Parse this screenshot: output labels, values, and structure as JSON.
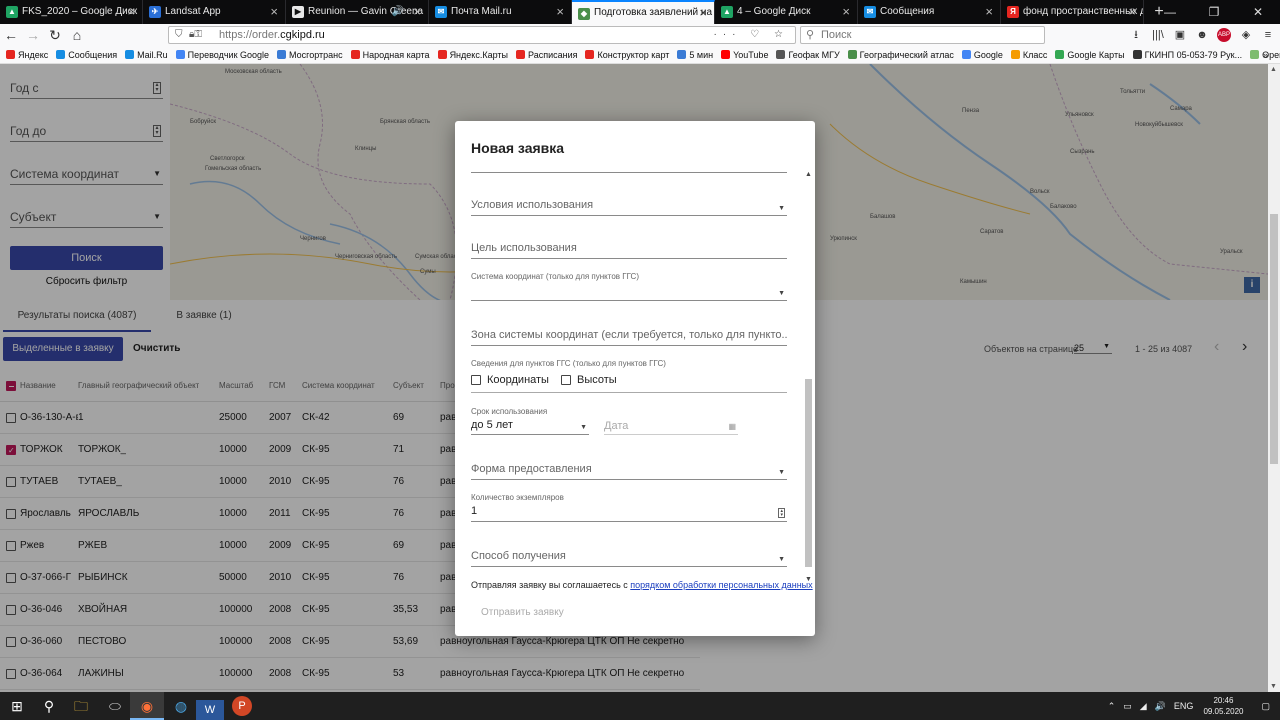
{
  "browser": {
    "tabs": [
      {
        "label": "FKS_2020 – Google Диск",
        "color": "#1fa463",
        "glyph": "▲"
      },
      {
        "label": "Landsat App",
        "color": "#2a6fd6",
        "glyph": "✈"
      },
      {
        "label": "Reunion — Gavin Greena",
        "color": "#e8e8e8",
        "glyph": "▶",
        "sound": "🔊"
      },
      {
        "label": "Почта Mail.ru",
        "color": "#168de2",
        "glyph": "✉"
      },
      {
        "label": "Подготовка заявлений на м",
        "color": "#4a8f4a",
        "glyph": "◆",
        "active": true
      },
      {
        "label": "4 – Google Диск",
        "color": "#1fa463",
        "glyph": "▲"
      },
      {
        "label": "Сообщения",
        "color": "#168de2",
        "glyph": "✉"
      },
      {
        "label": "фонд пространственных да",
        "color": "#e52620",
        "glyph": "Я"
      }
    ],
    "new_tab": "+",
    "window_controls": {
      "minimize": "—",
      "maximize": "❐",
      "close": "✕"
    },
    "nav": {
      "back": "←",
      "forward": "→",
      "reload": "↻",
      "home": "⌂"
    },
    "url_prefix": "https://order.",
    "url_host": "cgkipd.ru",
    "url_actions": "··· ♡ ☆",
    "search_placeholder": "Поиск",
    "toolbar_icons": [
      "⭳",
      "|||\\",
      "▣",
      "☻",
      "ABP",
      "◈",
      "≡"
    ],
    "bookmarks": [
      {
        "label": "Яндекс",
        "color": "#e52620"
      },
      {
        "label": "Сообщения",
        "color": "#168de2"
      },
      {
        "label": "Mail.Ru",
        "color": "#168de2"
      },
      {
        "label": "Переводчик Google",
        "color": "#4285f4"
      },
      {
        "label": "Мосгортранс",
        "color": "#3a7bd5"
      },
      {
        "label": "Народная карта",
        "color": "#e52620"
      },
      {
        "label": "Яндекс.Карты",
        "color": "#e52620"
      },
      {
        "label": "Расписания",
        "color": "#e52620"
      },
      {
        "label": "Конструктор карт",
        "color": "#e52620"
      },
      {
        "label": "5 мин",
        "color": "#3a7bd5"
      },
      {
        "label": "YouTube",
        "color": "#ff0000"
      },
      {
        "label": "Геофак МГУ",
        "color": "#555555"
      },
      {
        "label": "Географический атлас",
        "color": "#4a8f4a"
      },
      {
        "label": "Google",
        "color": "#4285f4"
      },
      {
        "label": "Класс",
        "color": "#f59b00"
      },
      {
        "label": "Google Карты",
        "color": "#34a853"
      },
      {
        "label": "ГКИНП 05-053-79 Рук...",
        "color": "#333333"
      },
      {
        "label": "OpenStreetMap",
        "color": "#7ebc6f"
      }
    ],
    "bookmarks_more": "»"
  },
  "filters": {
    "year_from": "Год с",
    "year_to": "Год до",
    "coord_system": "Система координат",
    "subject": "Субъект",
    "search_button": "Поиск",
    "reset_link": "Сбросить фильтр",
    "dropdown_glyph": "▼",
    "spin_glyph": "▲▼"
  },
  "map": {
    "info_button": "i",
    "cities": [
      "Московская область",
      "Бобруйск",
      "Клинцы",
      "Брянская область",
      "Гомельская область",
      "Светлогорск",
      "Чернигов",
      "Черниговская область",
      "Сумская область",
      "Сумы",
      "Пенза",
      "Саратов",
      "Самара",
      "Тольятти",
      "Ульяновск",
      "Сызрань",
      "Новокуйбышевск",
      "Балаково",
      "Вольск",
      "Камышин",
      "Урюпинск",
      "Балашов",
      "Уральск"
    ]
  },
  "results": {
    "tab_results": "Результаты поиска (4087)",
    "tab_order": "В заявке (1)",
    "selected_to_order": "Выделенные в заявку",
    "clear": "Очистить",
    "per_page_label": "Объектов на странице",
    "per_page_value": "25",
    "range": "1 - 25 из 4087",
    "prev": "‹",
    "next": "›",
    "headers": [
      "Название",
      "Главный географический объект",
      "Масштаб",
      "ГСМ",
      "Система координат",
      "Субъект",
      "Про"
    ],
    "rows": [
      {
        "name": "O-36-130-А-в",
        "geo": "1",
        "scale": "25000",
        "gsm": "2007",
        "cs": "СК-42",
        "subj": "69",
        "proj": "рав",
        "checked": false
      },
      {
        "name": "ТОРЖОК",
        "geo": "ТОРЖОК_",
        "scale": "10000",
        "gsm": "2009",
        "cs": "СК-95",
        "subj": "71",
        "proj": "рав",
        "checked": true
      },
      {
        "name": "ТУТАЕВ",
        "geo": "ТУТАЕВ_",
        "scale": "10000",
        "gsm": "2010",
        "cs": "СК-95",
        "subj": "76",
        "proj": "рав",
        "checked": false
      },
      {
        "name": "Ярославль",
        "geo": "ЯРОСЛАВЛЬ",
        "scale": "10000",
        "gsm": "2011",
        "cs": "СК-95",
        "subj": "76",
        "proj": "рав",
        "checked": false
      },
      {
        "name": "Ржев",
        "geo": "РЖЕВ",
        "scale": "10000",
        "gsm": "2009",
        "cs": "СК-95",
        "subj": "69",
        "proj": "рав",
        "checked": false
      },
      {
        "name": "O-37-066-Г",
        "geo": "РЫБИНСК",
        "scale": "50000",
        "gsm": "2010",
        "cs": "СК-95",
        "subj": "76",
        "proj": "рав",
        "checked": false
      },
      {
        "name": "O-36-046",
        "geo": "ХВОЙНАЯ",
        "scale": "100000",
        "gsm": "2008",
        "cs": "СК-95",
        "subj": "35,53",
        "proj": "рав",
        "checked": false
      },
      {
        "name": "O-36-060",
        "geo": "ПЕСТОВО",
        "scale": "100000",
        "gsm": "2008",
        "cs": "СК-95",
        "subj": "53,69",
        "proj": "равноугольная Гаусса-Крюгера  ЦТК ОП  Не секретно",
        "checked": false
      },
      {
        "name": "O-36-064",
        "geo": "ЛАЖИНЫ",
        "scale": "100000",
        "gsm": "2008",
        "cs": "СК-95",
        "subj": "53",
        "proj": "равноугольная Гаусса-Крюгера  ЦТК ОП  Не секретно",
        "checked": false
      }
    ]
  },
  "modal": {
    "title": "Новая заявка",
    "usage_terms": "Условия использования",
    "usage_purpose": "Цель использования",
    "coord_system_label": "Система координат (только для пунктов ГГС)",
    "coord_zone": "Зона системы координат (если требуется, только для пункто...",
    "ggs_label": "Сведения для пунктов ГГС (только для пунктов ГГС)",
    "coords_checkbox": "Координаты",
    "heights_checkbox": "Высоты",
    "term_label": "Срок использования",
    "term_value": "до 5 лет",
    "date_placeholder": "Дата",
    "calendar_glyph": "▦",
    "form_label": "Форма предоставления",
    "copies_label": "Количество экземпляров",
    "copies_value": "1",
    "method_label": "Способ получения",
    "agree_text": "Отправляя заявку вы соглашаетесь с ",
    "agree_link": "порядком обработки персональных данных",
    "submit": "Отправить заявку",
    "scroll_up": "▲",
    "scroll_down": "▼"
  },
  "taskbar": {
    "start": "⊞",
    "search": "⚲",
    "apps": [
      "🗀",
      "⬭",
      "◉",
      "◍",
      "W",
      "P"
    ],
    "tray_up": "⌃",
    "tray_icons": [
      "▭",
      "◢",
      "🔊"
    ],
    "lang": "ENG",
    "time": "20:46",
    "date": "09.05.2020",
    "notification": "▢"
  },
  "page_scroll": {
    "up": "▲",
    "down": "▼"
  }
}
